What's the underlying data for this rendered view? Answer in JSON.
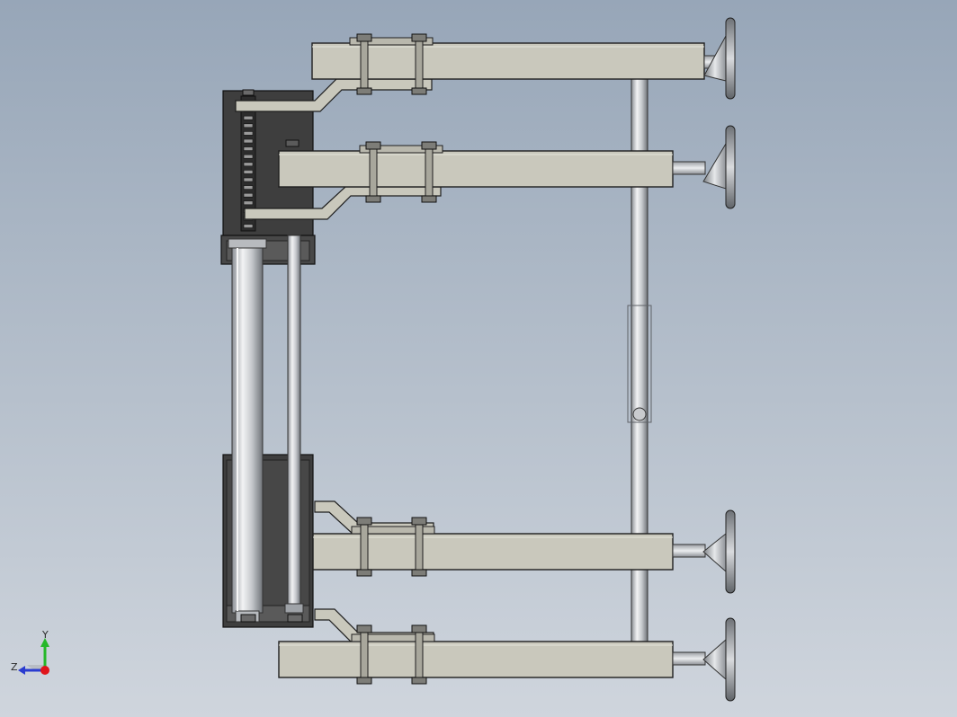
{
  "viewport": {
    "background_top": "#97a6b8",
    "background_bottom": "#cfd5dd"
  },
  "model": {
    "arms": 4,
    "leveling_feet": 4,
    "pneumatic_cylinders": 1,
    "guide_rods": 1
  },
  "colors": {
    "steel_beam": "#c9c8bc",
    "dark_plate": "#3f3f3f",
    "chrome": "#d7d9dc",
    "edge": "#1e1e1e"
  },
  "triad": {
    "x_label": "",
    "y_label": "Y",
    "z_label": "Z",
    "x_color": "#e0141b",
    "y_color": "#25b829",
    "z_color": "#2a3cd0"
  }
}
